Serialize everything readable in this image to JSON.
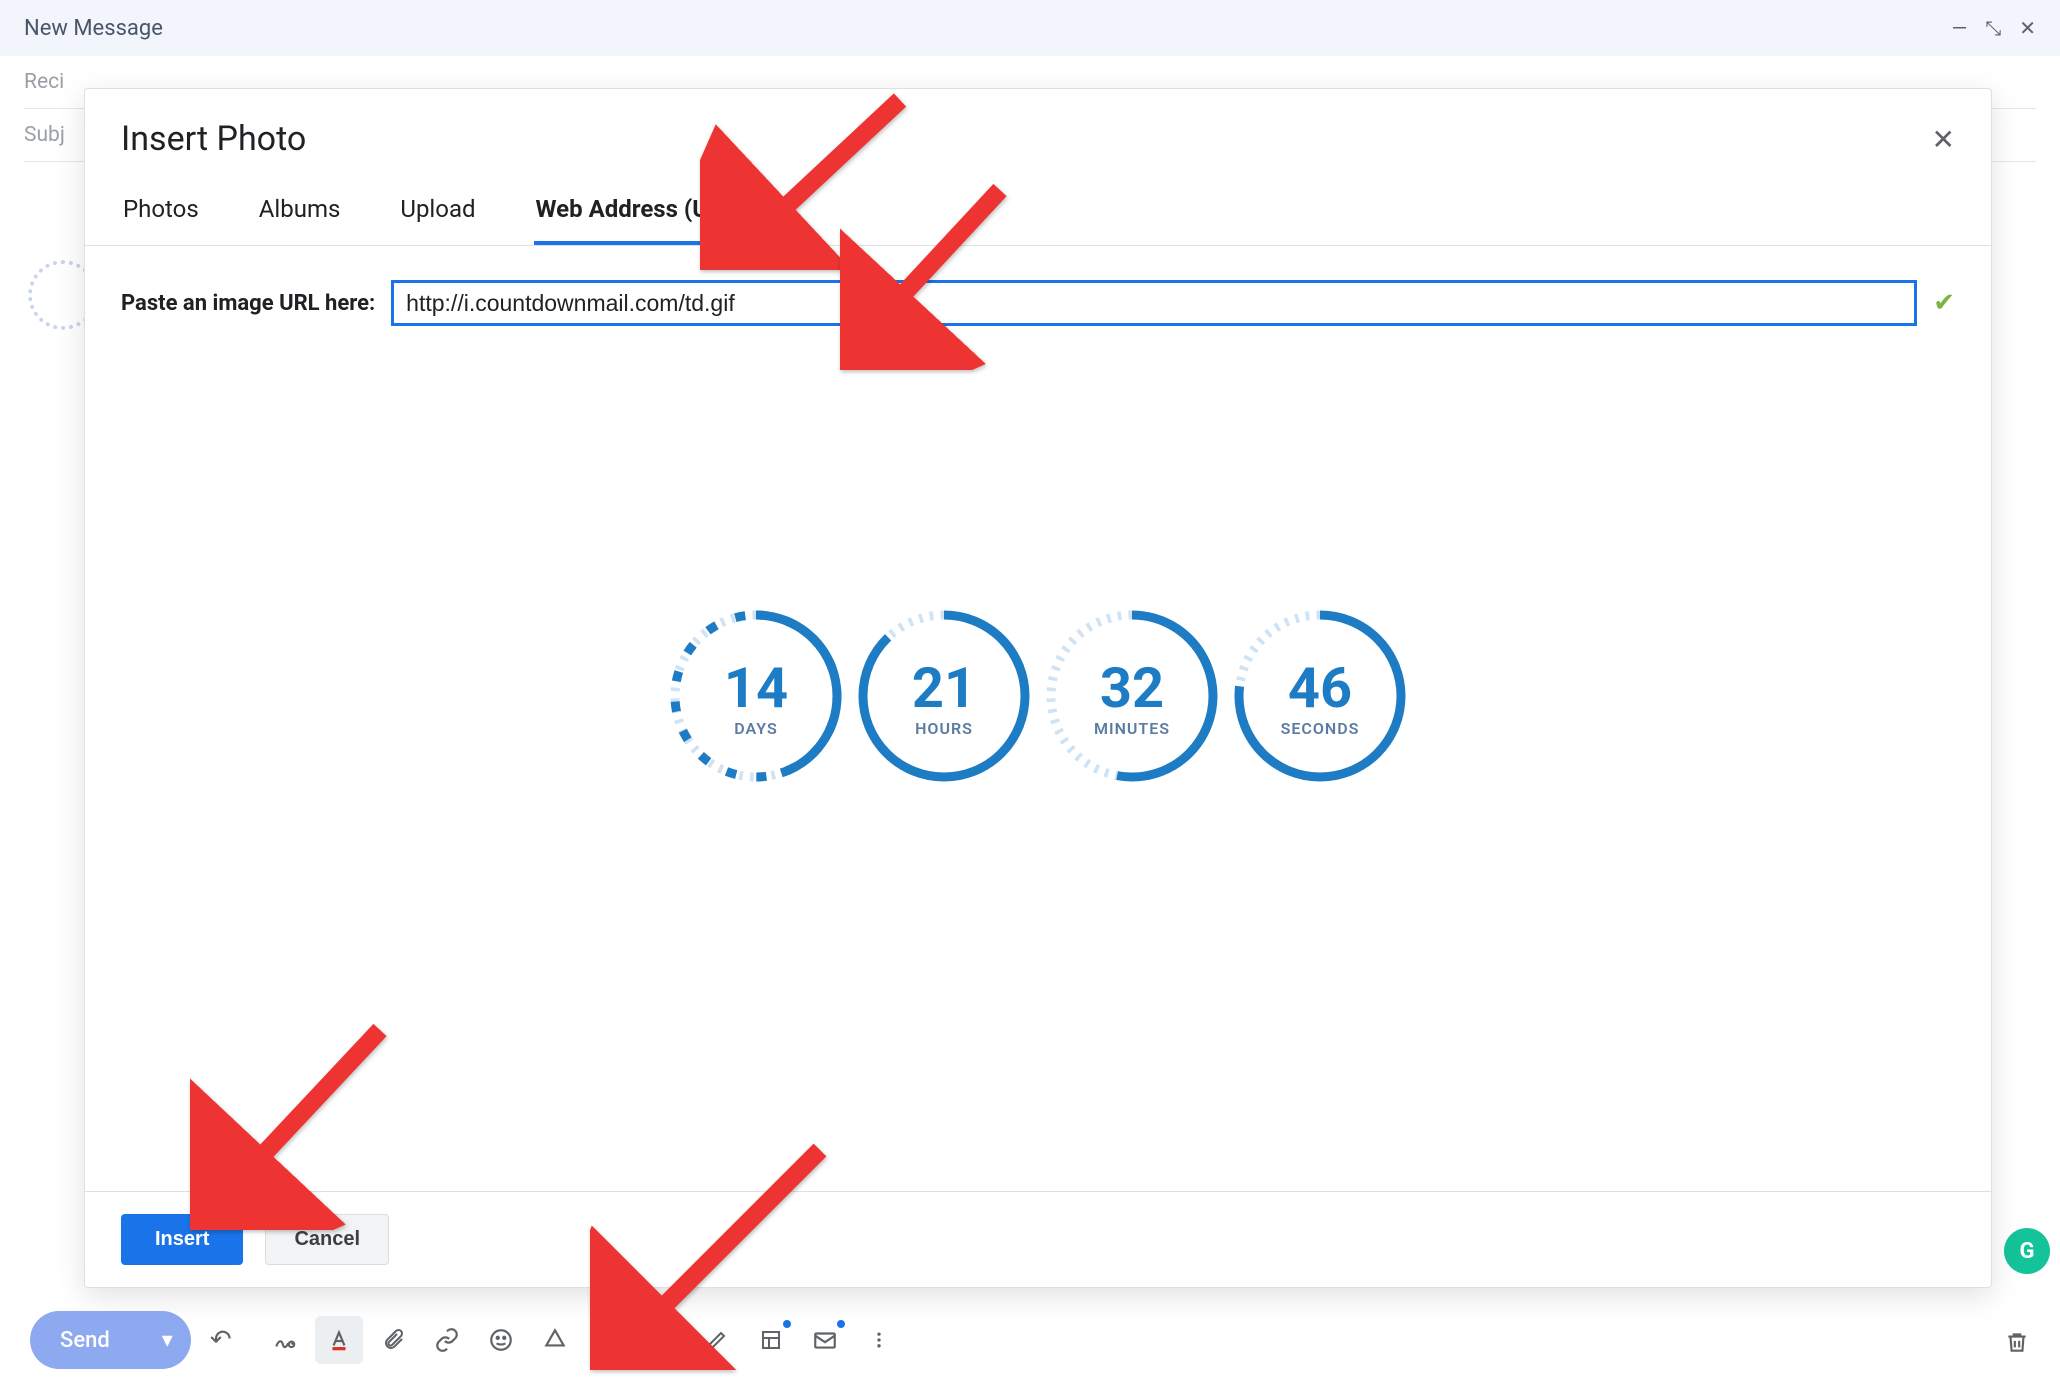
{
  "compose": {
    "title": "New Message",
    "recipients_label": "Reci",
    "subject_label": "Subj"
  },
  "bottombar": {
    "send_label": "Send"
  },
  "modal": {
    "title": "Insert Photo",
    "tabs": {
      "photos": "Photos",
      "albums": "Albums",
      "upload": "Upload",
      "web": "Web Address (URL)"
    },
    "url_label": "Paste an image URL here:",
    "url_value": "http://i.countdownmail.com/td.gif",
    "insert": "Insert",
    "cancel": "Cancel"
  },
  "countdown": {
    "days": {
      "value": "14",
      "label": "DAYS"
    },
    "hours": {
      "value": "21",
      "label": "HOURS"
    },
    "minutes": {
      "value": "32",
      "label": "MINUTES"
    },
    "seconds": {
      "value": "46",
      "label": "SECONDS"
    }
  }
}
